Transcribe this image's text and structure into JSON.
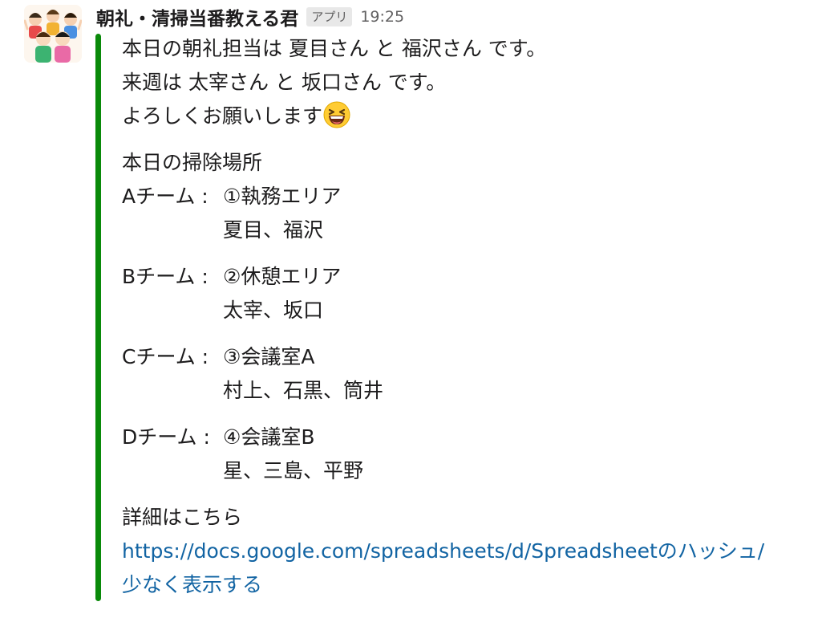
{
  "message": {
    "sender": "朝礼・清掃当番教える君",
    "badge": "アプリ",
    "time": "19:25",
    "accent_color": "#0a8a0a",
    "lines": [
      "本日の朝礼担当は 夏目さん と 福沢さん です。",
      "来週は 太宰さん と 坂口さん です。",
      "よろしくお願いします"
    ],
    "emoji": "laughing-face",
    "cleaning_heading": "本日の掃除場所",
    "teams": [
      {
        "label": "Aチーム :",
        "area": "①執務エリア",
        "members": "夏目、福沢"
      },
      {
        "label": "Bチーム :",
        "area": "②休憩エリア",
        "members": "太宰、坂口"
      },
      {
        "label": "Cチーム :",
        "area": "③会議室A",
        "members": "村上、石黒、筒井"
      },
      {
        "label": "Dチーム :",
        "area": "④会議室B",
        "members": "星、三島、平野"
      }
    ],
    "details_label": "詳細はこちら",
    "details_link": "https://docs.google.com/spreadsheets/d/Spreadsheetのハッシュ/",
    "show_less": "少なく表示する"
  }
}
